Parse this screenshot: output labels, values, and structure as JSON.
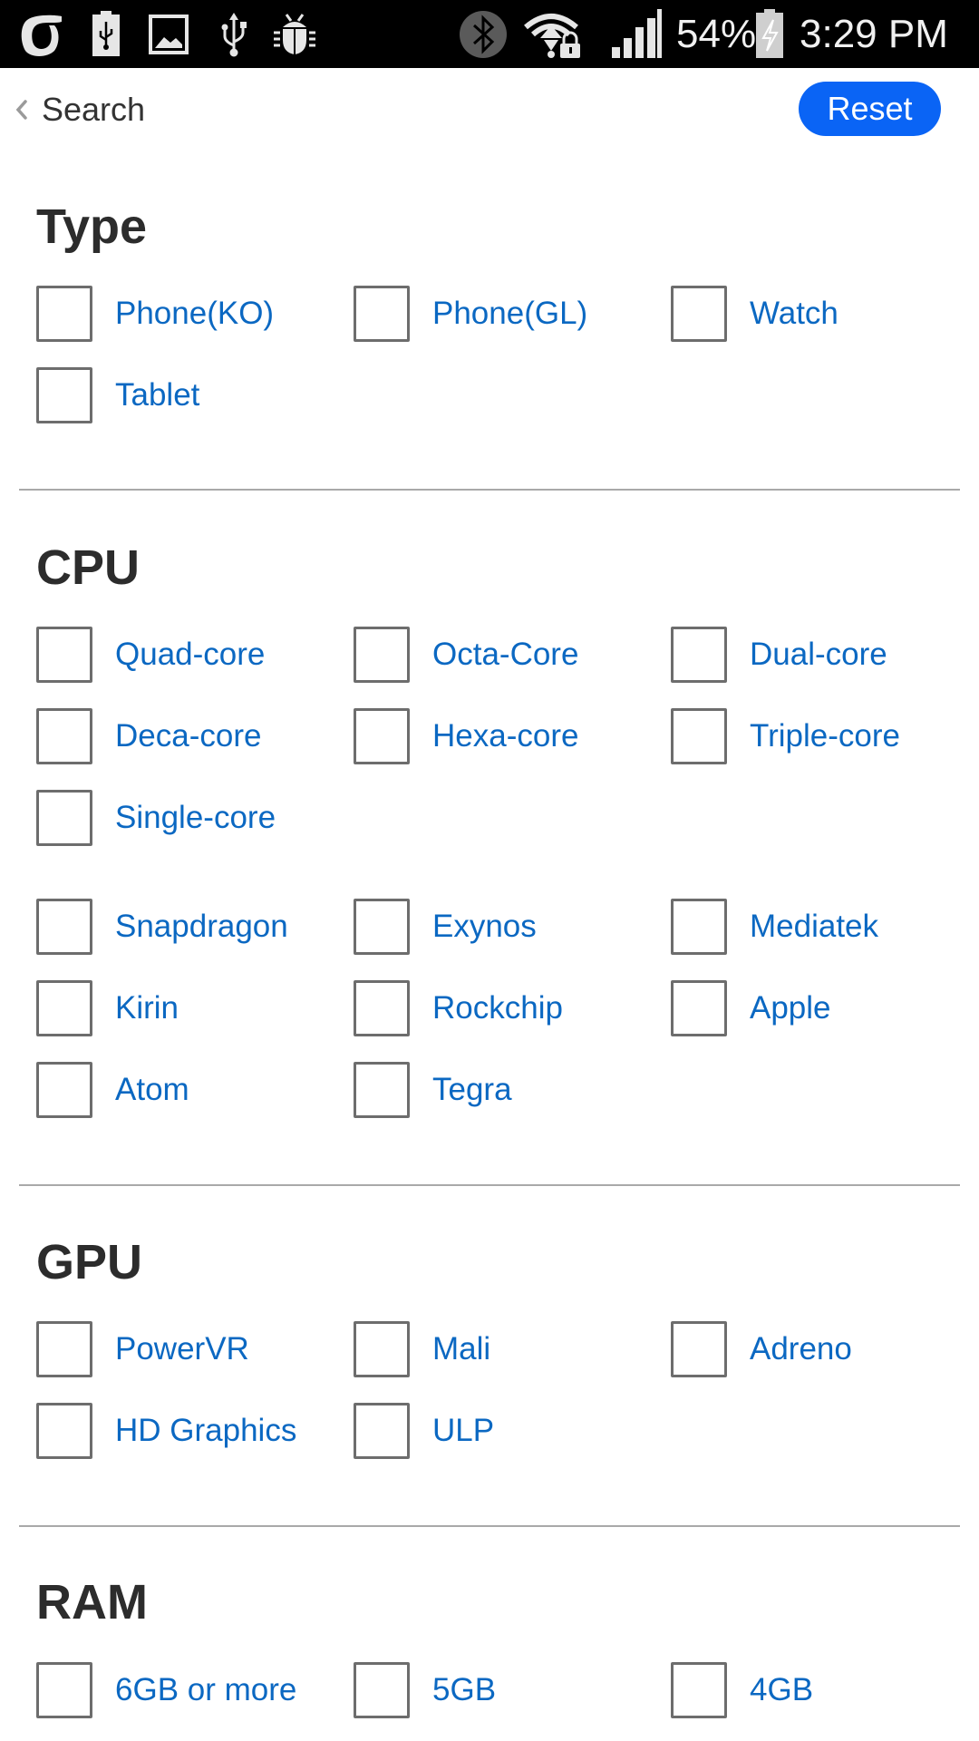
{
  "status_bar": {
    "left_icons": [
      "carrier-logo-icon",
      "usb-battery-icon",
      "gallery-icon",
      "usb-icon",
      "debug-bug-icon"
    ],
    "right_icons": [
      "bluetooth-icon",
      "wifi-locked-icon",
      "signal-icon",
      "battery-charging-icon"
    ],
    "battery_percent": "54%",
    "time": "3:29 PM"
  },
  "nav": {
    "back_label": "Search",
    "reset_label": "Reset"
  },
  "colors": {
    "accent": "#0a64f5",
    "link": "#0b68c2",
    "heading": "#2c2c2c",
    "checkbox_border": "#6d6d6d",
    "divider": "#a9a9a9"
  },
  "sections": [
    {
      "title": "Type",
      "groups": [
        [
          {
            "label": "Phone(KO)",
            "checked": false
          },
          {
            "label": "Phone(GL)",
            "checked": false
          },
          {
            "label": "Watch",
            "checked": false
          },
          {
            "label": "Tablet",
            "checked": false
          }
        ]
      ]
    },
    {
      "title": "CPU",
      "groups": [
        [
          {
            "label": "Quad-core",
            "checked": false
          },
          {
            "label": "Octa-Core",
            "checked": false
          },
          {
            "label": "Dual-core",
            "checked": false
          },
          {
            "label": "Deca-core",
            "checked": false
          },
          {
            "label": "Hexa-core",
            "checked": false
          },
          {
            "label": "Triple-core",
            "checked": false
          },
          {
            "label": "Single-core",
            "checked": false
          }
        ],
        [
          {
            "label": "Snapdragon",
            "checked": false
          },
          {
            "label": "Exynos",
            "checked": false
          },
          {
            "label": "Mediatek",
            "checked": false
          },
          {
            "label": "Kirin",
            "checked": false
          },
          {
            "label": "Rockchip",
            "checked": false
          },
          {
            "label": "Apple",
            "checked": false
          },
          {
            "label": "Atom",
            "checked": false
          },
          {
            "label": "Tegra",
            "checked": false
          }
        ]
      ]
    },
    {
      "title": "GPU",
      "groups": [
        [
          {
            "label": "PowerVR",
            "checked": false
          },
          {
            "label": "Mali",
            "checked": false
          },
          {
            "label": "Adreno",
            "checked": false
          },
          {
            "label": "HD Graphics",
            "checked": false
          },
          {
            "label": "ULP",
            "checked": false
          }
        ]
      ]
    },
    {
      "title": "RAM",
      "groups": [
        [
          {
            "label": "6GB or more",
            "checked": false
          },
          {
            "label": "5GB",
            "checked": false
          },
          {
            "label": "4GB",
            "checked": false
          }
        ]
      ]
    }
  ]
}
